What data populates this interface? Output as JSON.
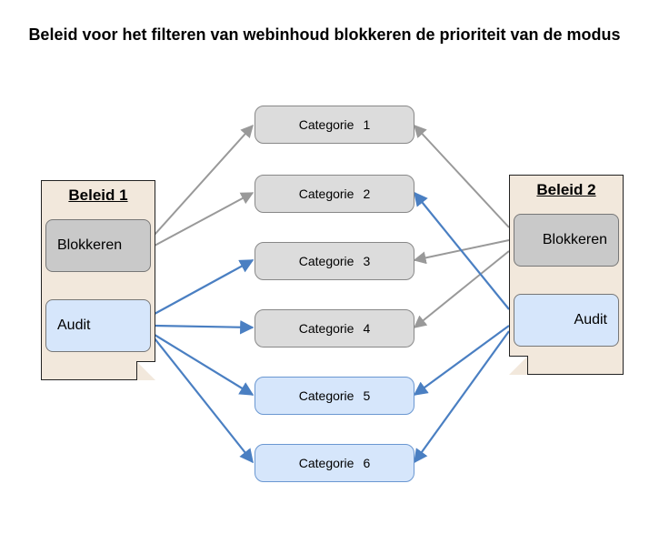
{
  "title": "Beleid voor het filteren van webinhoud blokkeren de prioriteit van de modus",
  "policies": {
    "p1": {
      "label": "Beleid 1",
      "block": "Blokkeren",
      "audit": "Audit"
    },
    "p2": {
      "label": "Beleid 2",
      "block": "Blokkeren",
      "audit": "Audit"
    }
  },
  "categories": {
    "word": "Categorie",
    "c1": "1",
    "c2": "2",
    "c3": "3",
    "c4": "4",
    "c5": "5",
    "c6": "6"
  },
  "colors": {
    "gray_arrow": "#999999",
    "blue_arrow": "#4a7fc2"
  },
  "connections": {
    "policy1_block_to": [
      "c1",
      "c2"
    ],
    "policy1_audit_to": [
      "c3",
      "c4",
      "c5",
      "c6"
    ],
    "policy2_block_to": [
      "c1",
      "c3",
      "c4"
    ],
    "policy2_audit_to": [
      "c2",
      "c5",
      "c6"
    ]
  }
}
